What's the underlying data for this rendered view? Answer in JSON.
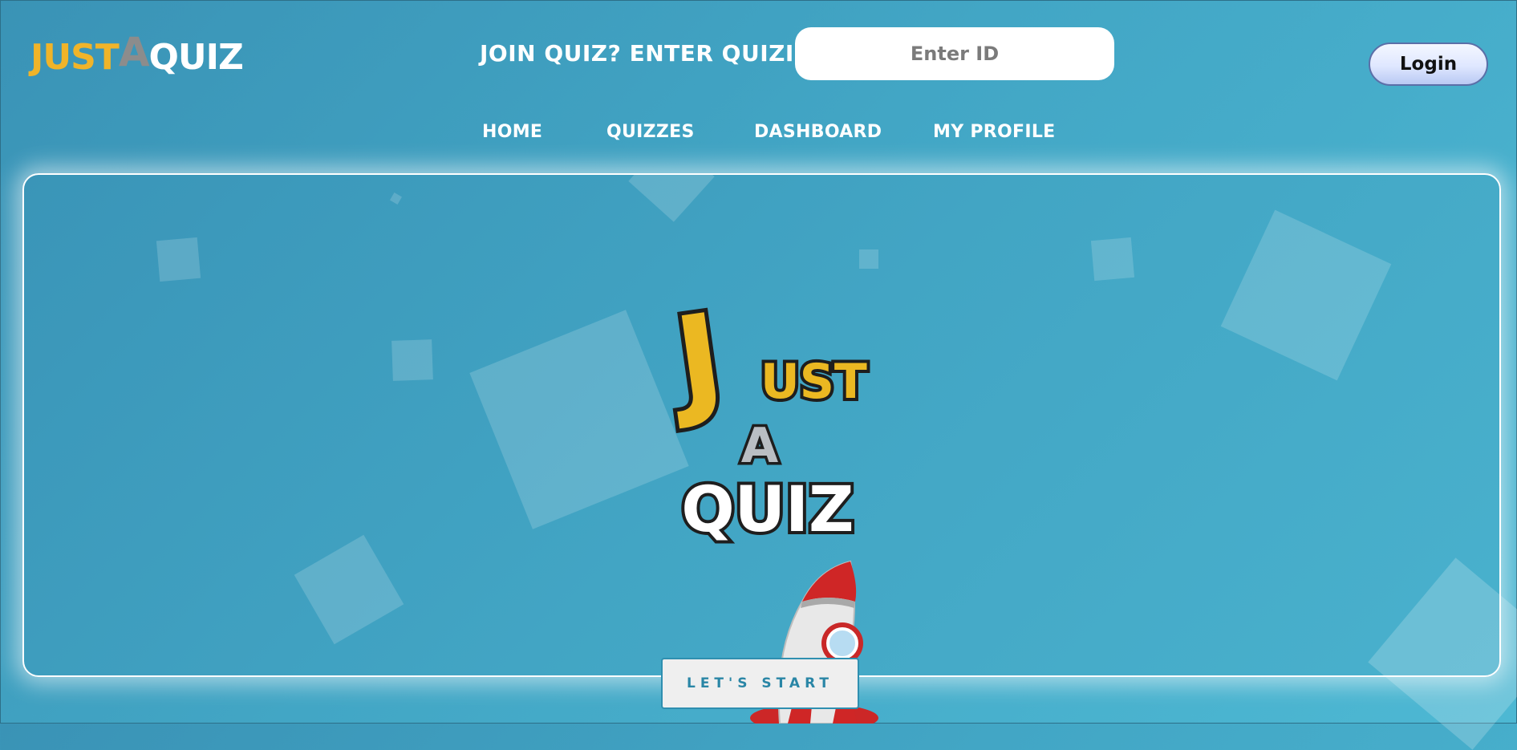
{
  "header": {
    "logo": {
      "part1": "JUST",
      "part2": "A",
      "part3": "QUIZ"
    },
    "join_label": "JOIN QUIZ? ENTER QUIZID:",
    "quiz_id_placeholder": "Enter ID",
    "login_label": "Login"
  },
  "nav": {
    "items": [
      {
        "label": "HOME"
      },
      {
        "label": "QUIZZES"
      },
      {
        "label": "DASHBOARD"
      },
      {
        "label": "MY PROFILE"
      }
    ]
  },
  "hero": {
    "logo_lines": {
      "big_letter": "J",
      "rest": "UST",
      "middle": "A",
      "last": "QUIZ"
    },
    "start_label": "LET'S START"
  },
  "colors": {
    "background": "#42a6c5",
    "logo_yellow": "#f0b429",
    "logo_gray": "#8c8c8c",
    "text_white": "#ffffff",
    "rocket_red": "#d42a2a"
  },
  "icons": {
    "rocket": "rocket-icon"
  }
}
